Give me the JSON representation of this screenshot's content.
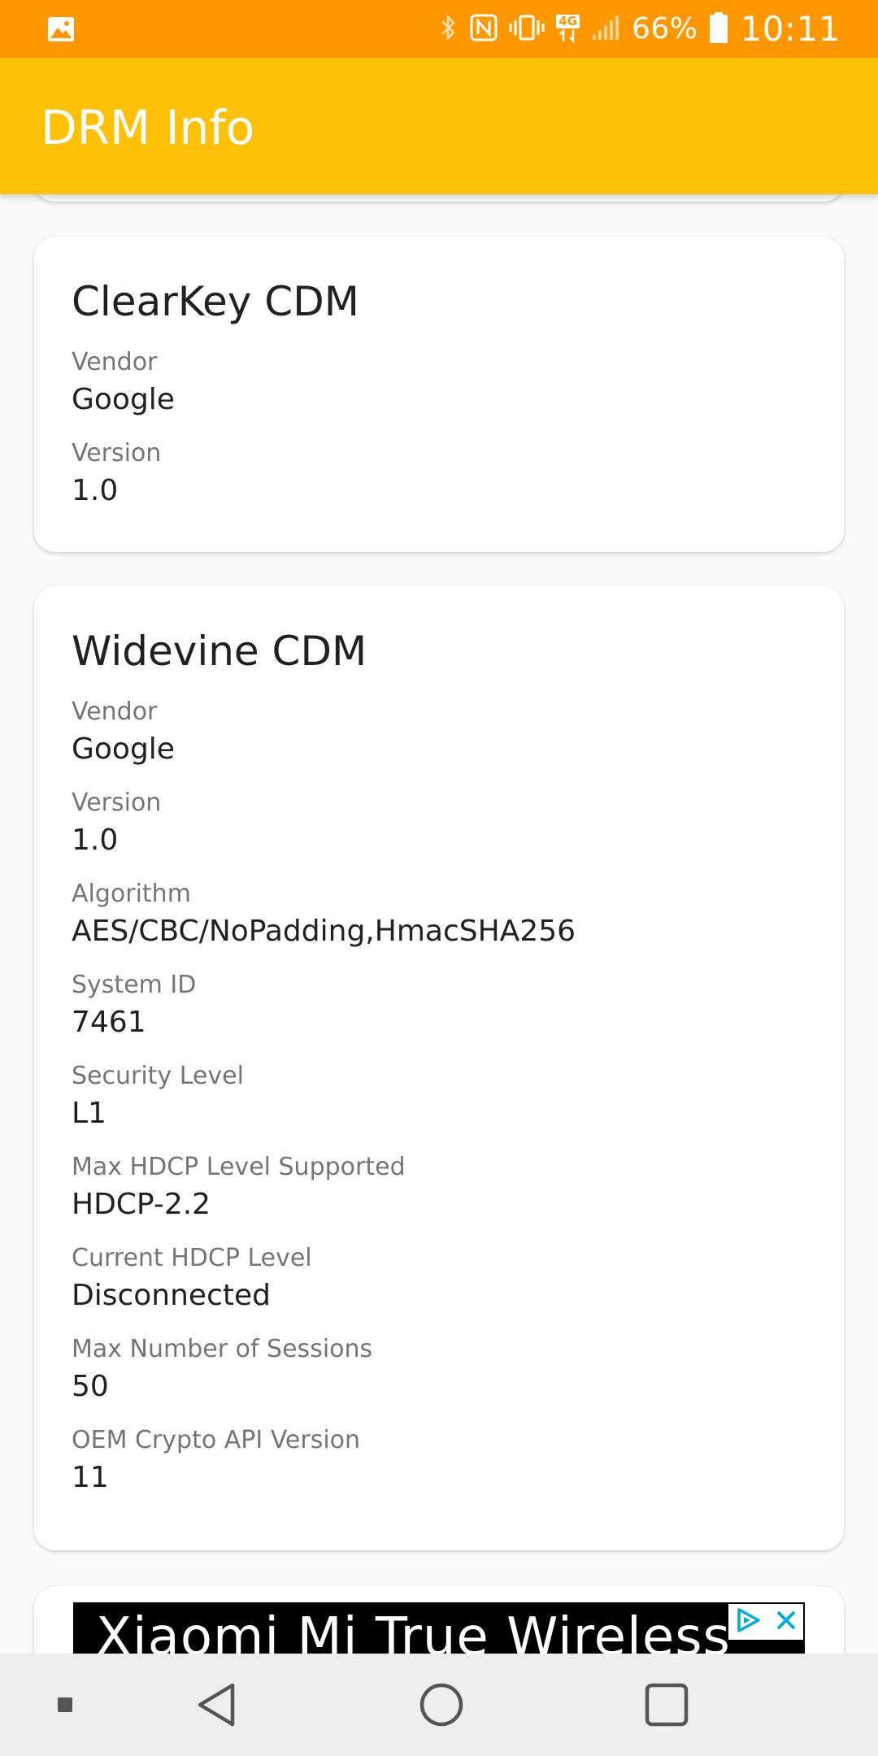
{
  "status_bar": {
    "battery_percent": "66%",
    "time": "10:11",
    "network_badge": "4G"
  },
  "app_bar": {
    "title": "DRM Info"
  },
  "cards": [
    {
      "title": "ClearKey CDM",
      "fields": [
        {
          "label": "Vendor",
          "value": "Google"
        },
        {
          "label": "Version",
          "value": "1.0"
        }
      ]
    },
    {
      "title": "Widevine CDM",
      "fields": [
        {
          "label": "Vendor",
          "value": "Google"
        },
        {
          "label": "Version",
          "value": "1.0"
        },
        {
          "label": "Algorithm",
          "value": "AES/CBC/NoPadding,HmacSHA256"
        },
        {
          "label": "System ID",
          "value": "7461"
        },
        {
          "label": "Security Level",
          "value": "L1"
        },
        {
          "label": "Max HDCP Level Supported",
          "value": "HDCP-2.2"
        },
        {
          "label": "Current HDCP Level",
          "value": "Disconnected"
        },
        {
          "label": "Max Number of Sessions",
          "value": "50"
        },
        {
          "label": "OEM Crypto API Version",
          "value": "11"
        }
      ]
    }
  ],
  "ad": {
    "text": "Xiaomi Mi True Wireless"
  },
  "colors": {
    "status_bar": "#ff9800",
    "app_bar": "#ffc107",
    "ad_accent": "#00aecd"
  }
}
